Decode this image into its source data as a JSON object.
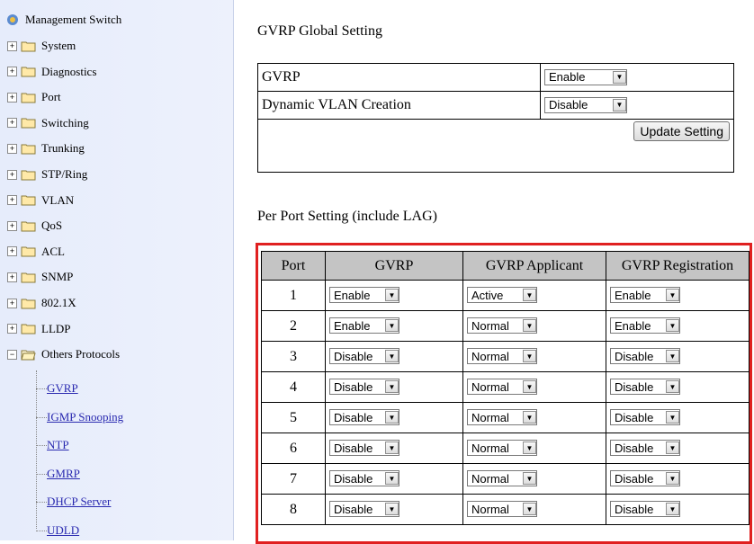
{
  "sidebar": {
    "root_label": "Management Switch",
    "items": [
      {
        "label": "System"
      },
      {
        "label": "Diagnostics"
      },
      {
        "label": "Port"
      },
      {
        "label": "Switching"
      },
      {
        "label": "Trunking"
      },
      {
        "label": "STP/Ring"
      },
      {
        "label": "VLAN"
      },
      {
        "label": "QoS"
      },
      {
        "label": "ACL"
      },
      {
        "label": "SNMP"
      },
      {
        "label": "802.1X"
      },
      {
        "label": "LLDP"
      },
      {
        "label": "Others Protocols"
      }
    ],
    "subitems": [
      {
        "label": "GVRP"
      },
      {
        "label": "IGMP Snooping"
      },
      {
        "label": "NTP"
      },
      {
        "label": "GMRP"
      },
      {
        "label": "DHCP Server"
      },
      {
        "label": "UDLD"
      }
    ],
    "expander_plus": "+",
    "expander_minus": "−"
  },
  "global": {
    "title": "GVRP Global Setting",
    "rows": [
      {
        "label": "GVRP",
        "value": "Enable"
      },
      {
        "label": "Dynamic VLAN Creation",
        "value": "Disable"
      }
    ],
    "update_button": "Update Setting"
  },
  "per_port": {
    "title": "Per Port Setting (include LAG)",
    "headers": [
      "Port",
      "GVRP",
      "GVRP Applicant",
      "GVRP Registration"
    ],
    "rows": [
      {
        "port": "1",
        "gvrp": "Enable",
        "applicant": "Active",
        "registration": "Enable"
      },
      {
        "port": "2",
        "gvrp": "Enable",
        "applicant": "Normal",
        "registration": "Enable"
      },
      {
        "port": "3",
        "gvrp": "Disable",
        "applicant": "Normal",
        "registration": "Disable"
      },
      {
        "port": "4",
        "gvrp": "Disable",
        "applicant": "Normal",
        "registration": "Disable"
      },
      {
        "port": "5",
        "gvrp": "Disable",
        "applicant": "Normal",
        "registration": "Disable"
      },
      {
        "port": "6",
        "gvrp": "Disable",
        "applicant": "Normal",
        "registration": "Disable"
      },
      {
        "port": "7",
        "gvrp": "Disable",
        "applicant": "Normal",
        "registration": "Disable"
      },
      {
        "port": "8",
        "gvrp": "Disable",
        "applicant": "Normal",
        "registration": "Disable"
      }
    ]
  },
  "colors": {
    "highlight_border": "#e02020",
    "header_bg": "#c4c4c4",
    "link": "#2a2ab0"
  }
}
